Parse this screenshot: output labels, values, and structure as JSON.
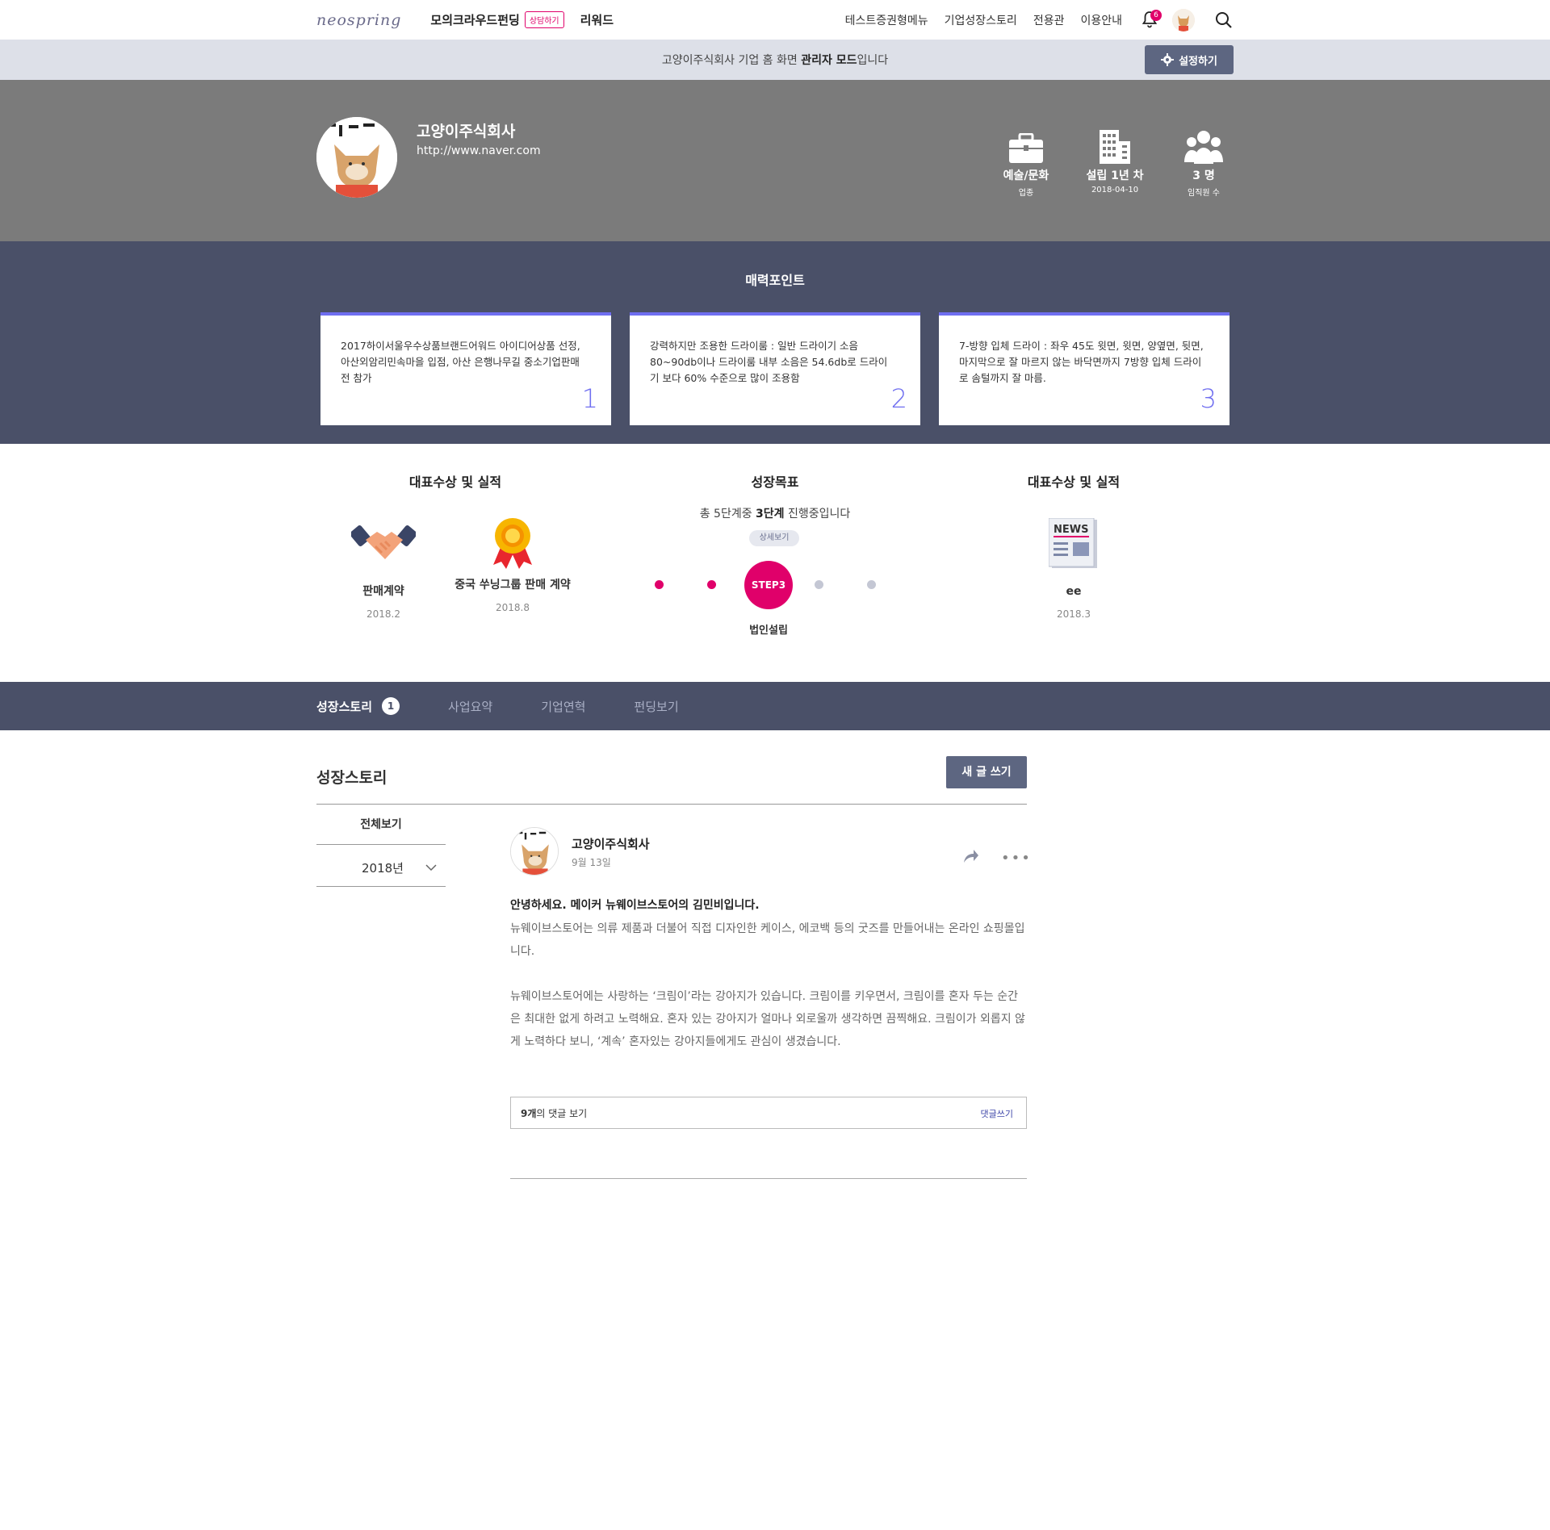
{
  "nav": {
    "logo": "neospring",
    "main_link": "모의크라우드펀딩",
    "pill": "상담하기",
    "reward": "리워드",
    "links": [
      "테스트증권형메뉴",
      "기업성장스토리",
      "전용관",
      "이용안내"
    ],
    "notification_count": "6",
    "icons": [
      "bell-icon",
      "avatar",
      "search-icon"
    ]
  },
  "admin": {
    "text_before": "고양이주식회사 기업 홈 화면 ",
    "text_bold": "관리자 모드",
    "text_after": "입니다",
    "settings_label": "설정하기"
  },
  "company": {
    "name": "고양이주식회사",
    "url": "http://www.naver.com",
    "stats": [
      {
        "icon": "briefcase-icon",
        "value": "예술/문화",
        "sub": "업종"
      },
      {
        "icon": "building-icon",
        "value": "설립 1년 차",
        "sub": "2018-04-10"
      },
      {
        "icon": "people-icon",
        "value": "3 명",
        "sub": "임직원 수"
      }
    ]
  },
  "attraction": {
    "title": "매력포인트",
    "cards": [
      {
        "text": "2017하이서울우수상품브랜드어워드 아이디어상품 선정, 아산외암리민속마을 입점, 아산 은행나무길 중소기업판매전 참가",
        "num": "1"
      },
      {
        "text": "강력하지만 조용한 드라이룸 : 일반 드라이기 소음 80~90db이나 드라이룸 내부 소음은 54.6db로 드라이기 보다 60% 수준으로 많이 조용함",
        "num": "2"
      },
      {
        "text": "7-방향 입체 드라이 : 좌우 45도 윗면, 윗면, 양옆면, 뒷면, 마지막으로 잘 마르지 않는 바닥면까지 7방향 입체 드라이로 솜털까지 잘 마름.",
        "num": "3"
      }
    ]
  },
  "achievements_left": {
    "title": "대표수상 및 실적",
    "items": [
      {
        "icon": "handshake-icon",
        "name": "판매계약",
        "date": "2018.2"
      },
      {
        "icon": "medal-icon",
        "name": "중국 쑤닝그룹 판매 계약",
        "date": "2018.8"
      }
    ]
  },
  "growth": {
    "title": "성장목표",
    "desc_before": "총 5단계중 ",
    "desc_bold": "3단계",
    "desc_after": " 진행중입니다",
    "detail_label": "상세보기",
    "current_step": "STEP3",
    "current_label": "법인설립",
    "total_steps": 5,
    "current_index": 3
  },
  "achievements_right": {
    "title": "대표수상 및 실적",
    "items": [
      {
        "icon": "news-icon",
        "name": "ee",
        "date": "2018.3"
      }
    ]
  },
  "tabs": [
    {
      "label": "성장스토리",
      "count": "1",
      "active": true
    },
    {
      "label": "사업요약"
    },
    {
      "label": "기업연혁"
    },
    {
      "label": "펀딩보기"
    }
  ],
  "story": {
    "title": "성장스토리",
    "write_label": "새 글 쓰기",
    "side_all": "전체보기",
    "side_year": "2018년"
  },
  "post": {
    "author": "고양이주식회사",
    "date": "9월 13일",
    "headline": "안녕하세요. 메이커 뉴웨이브스토어의 김민비입니다.",
    "paragraph1": "뉴웨이브스토어는 의류 제품과 더불어 직접 디자인한 케이스, 에코백 등의 굿즈를 만들어내는 온라인 쇼핑몰입니다.",
    "paragraph2": "뉴웨이브스토어에는 사랑하는 ‘크림이’라는 강아지가 있습니다. 크림이를 키우면서, 크림이를 혼자 두는 순간은 최대한 없게 하려고 노력해요. 혼자 있는 강아지가 얼마나 외로울까 생각하면 끔찍해요. 크림이가 외롭지 않게 노력하다 보니, ‘계속’ 혼자있는 강아지들에게도 관심이 생겼습니다.",
    "comments_count_bold": "9개",
    "comments_count_rest": "의 댓글 보기",
    "comments_write": "댓글쓰기"
  },
  "colors": {
    "accent": "#e0006a",
    "navy": "#4a5068",
    "slate_button": "#5d6681",
    "card_accent": "#6f6ef0",
    "header_gray": "#7b7b7b",
    "admin_bar": "#dde0e8"
  }
}
